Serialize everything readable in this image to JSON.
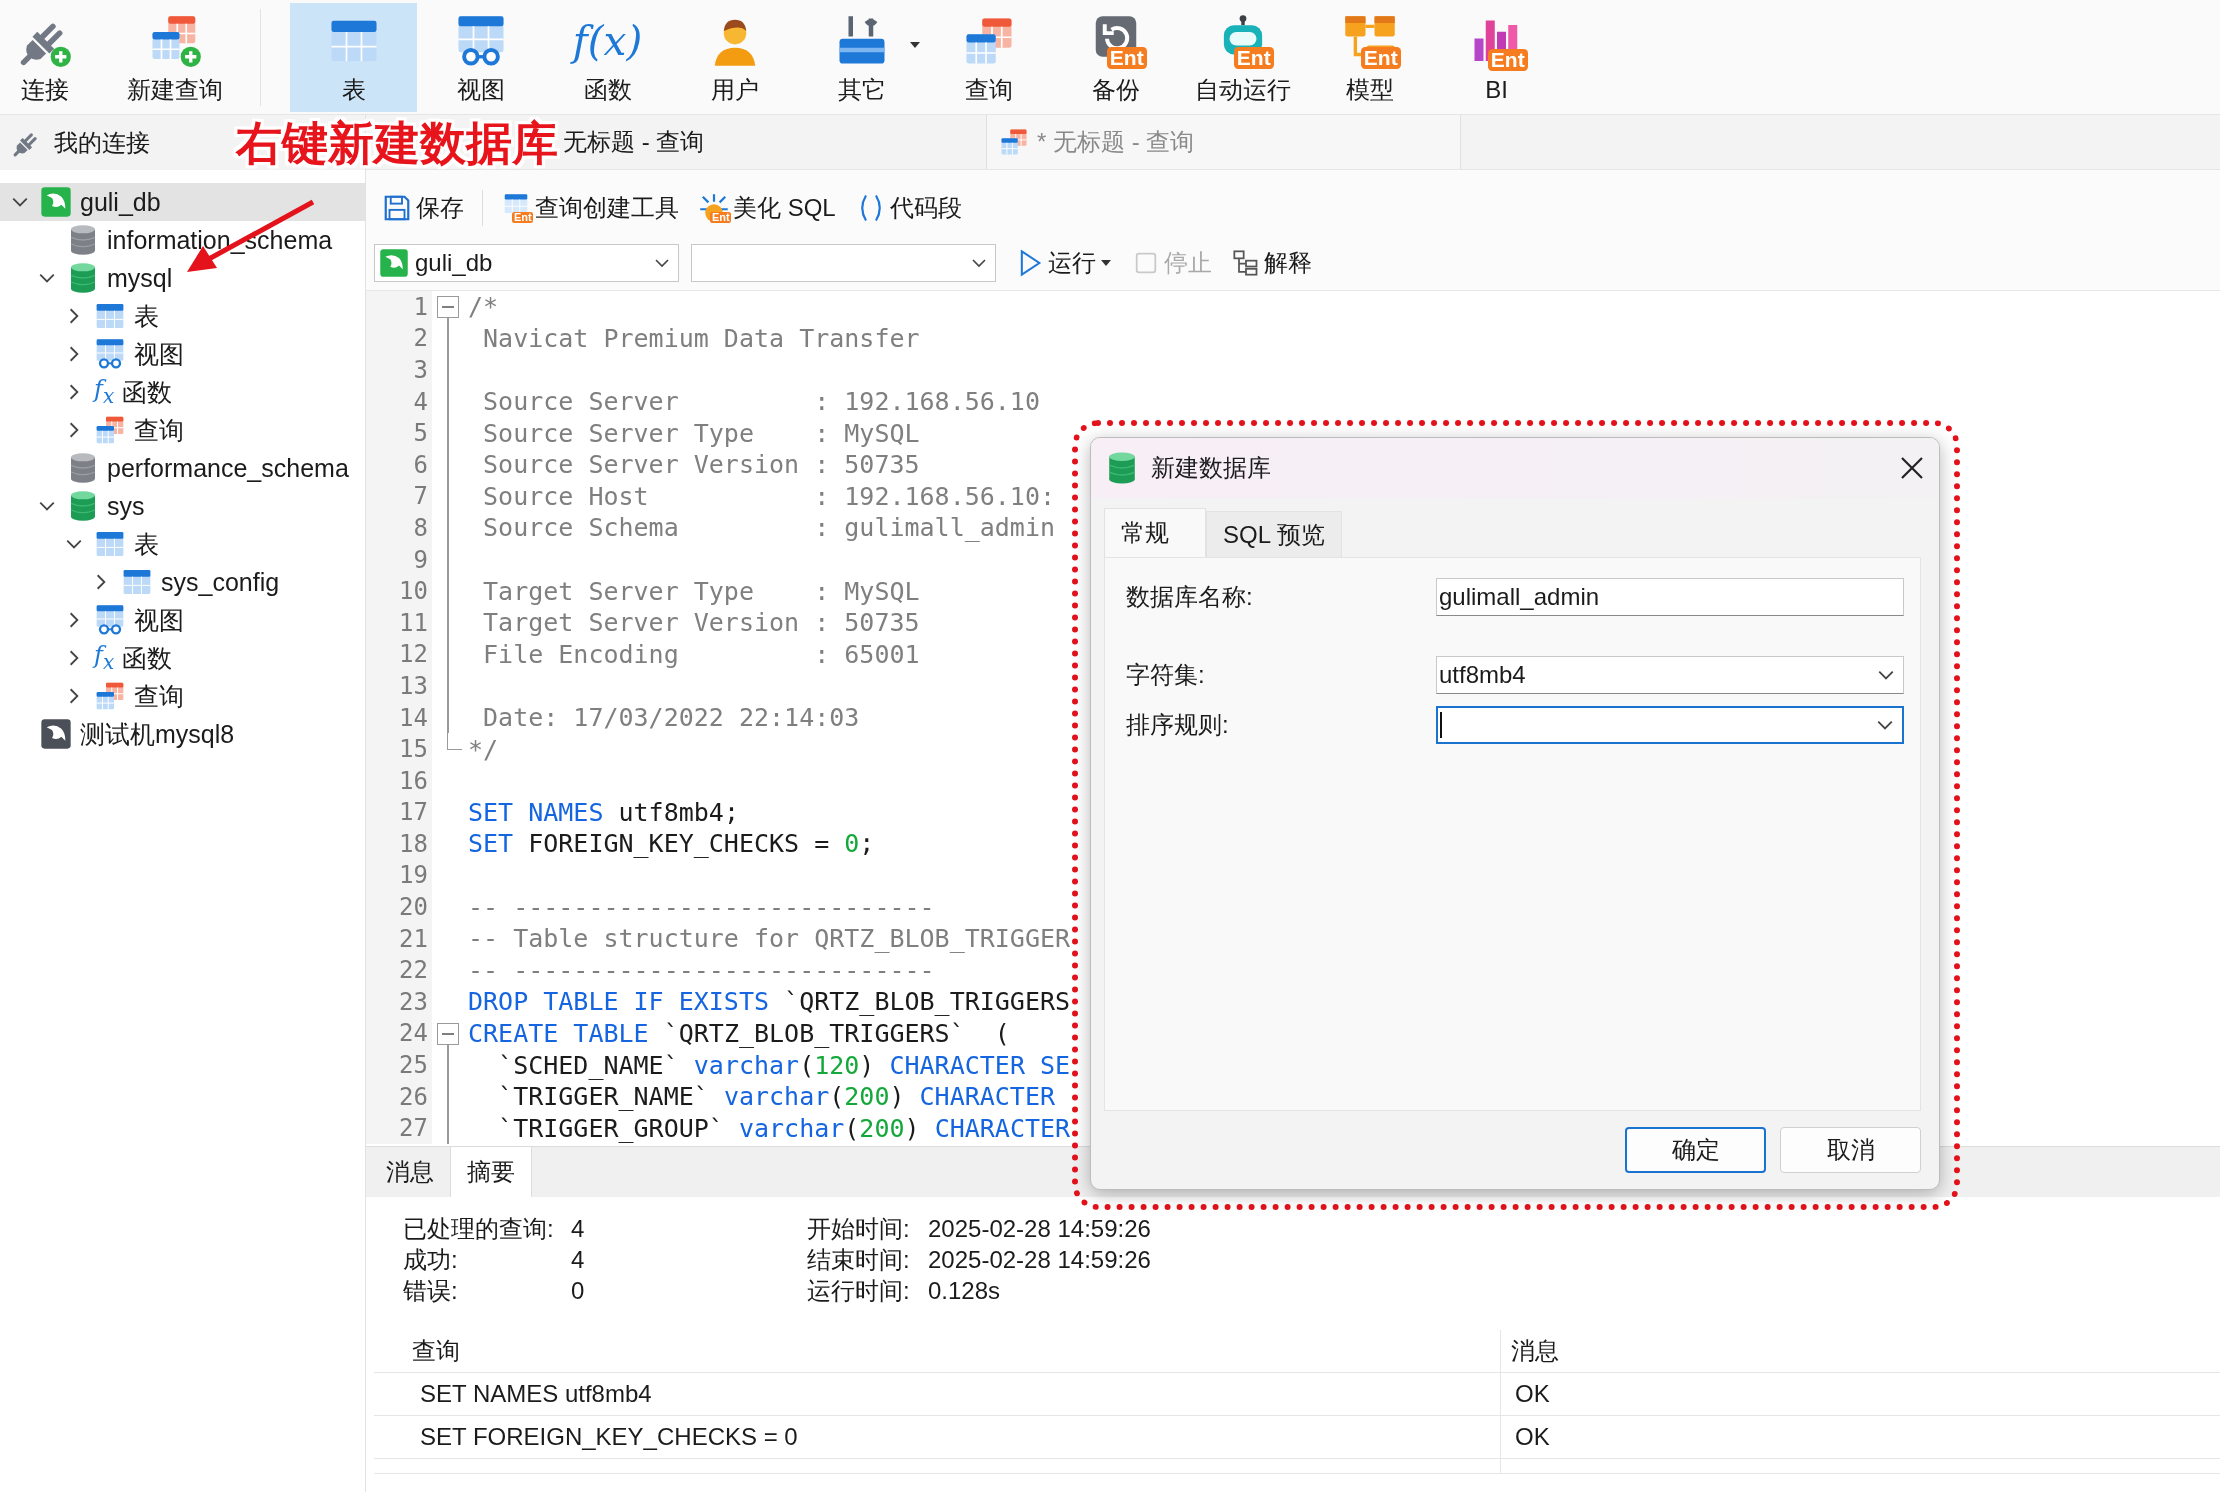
{
  "toolbar": {
    "items": [
      {
        "label": "连接",
        "kind": "connection",
        "selected": false,
        "dropdown": false
      },
      {
        "label": "新建查询",
        "kind": "new-query",
        "selected": false,
        "dropdown": false
      },
      {
        "label": "表",
        "kind": "table",
        "selected": true,
        "dropdown": false
      },
      {
        "label": "视图",
        "kind": "view",
        "selected": false,
        "dropdown": false
      },
      {
        "label": "函数",
        "kind": "function",
        "glyph": "f(x)",
        "selected": false,
        "dropdown": false
      },
      {
        "label": "用户",
        "kind": "user",
        "selected": false,
        "dropdown": false
      },
      {
        "label": "其它",
        "kind": "tools",
        "selected": false,
        "dropdown": true
      },
      {
        "label": "查询",
        "kind": "query",
        "selected": false,
        "dropdown": false
      },
      {
        "label": "备份",
        "kind": "backup",
        "badge": "Ent",
        "selected": false,
        "dropdown": false
      },
      {
        "label": "自动运行",
        "kind": "robot",
        "badge": "Ent",
        "selected": false,
        "dropdown": false
      },
      {
        "label": "模型",
        "kind": "model",
        "badge": "Ent",
        "selected": false,
        "dropdown": false
      },
      {
        "label": "BI",
        "kind": "bi",
        "badge": "Ent",
        "selected": false,
        "dropdown": false
      }
    ]
  },
  "annotation": {
    "text": "右键新建数据库"
  },
  "sidebar": {
    "title": "我的连接",
    "tree": [
      {
        "label": "guli_db",
        "kind": "connection",
        "opened": true,
        "expanded": true,
        "selected": true,
        "children": [
          {
            "label": "information_schema",
            "kind": "database",
            "opened": false,
            "selected": false
          },
          {
            "label": "mysql",
            "kind": "database",
            "opened": true,
            "expanded": true,
            "selected": false,
            "children": [
              {
                "label": "表",
                "kind": "table",
                "expanded": false,
                "selected": false
              },
              {
                "label": "视图",
                "kind": "view",
                "expanded": false,
                "selected": false
              },
              {
                "label": "函数",
                "kind": "function",
                "glyph": "f$_{x}$",
                "expanded": false,
                "selected": false
              },
              {
                "label": "查询",
                "kind": "query",
                "expanded": false,
                "selected": false
              }
            ]
          },
          {
            "label": "performance_schema",
            "kind": "database",
            "opened": false,
            "selected": false
          },
          {
            "label": "sys",
            "kind": "database",
            "opened": true,
            "expanded": true,
            "selected": false,
            "children": [
              {
                "label": "表",
                "kind": "table",
                "expanded": true,
                "selected": false,
                "children": [
                  {
                    "label": "sys_config",
                    "kind": "table",
                    "expanded": false,
                    "selected": false
                  }
                ]
              },
              {
                "label": "视图",
                "kind": "view",
                "expanded": false,
                "selected": false
              },
              {
                "label": "函数",
                "kind": "function",
                "glyph": "f$_{x}$",
                "expanded": false,
                "selected": false
              },
              {
                "label": "查询",
                "kind": "query",
                "expanded": false,
                "selected": false
              }
            ]
          }
        ]
      },
      {
        "label": "测试机mysql8",
        "kind": "connection",
        "opened": false,
        "selected": false
      }
    ]
  },
  "tabs": [
    {
      "label": "无标题 - 查询",
      "selected": true
    },
    {
      "label": "* 无标题 - 查询",
      "selected": false
    }
  ],
  "editor_toolbar": {
    "buttons": [
      {
        "label": "保存"
      },
      {
        "label": "查询创建工具",
        "badge": "Ent"
      },
      {
        "label": "美化 SQL",
        "badge": "Ent"
      },
      {
        "label": "代码段"
      }
    ],
    "database": "guli_db",
    "actions": [
      {
        "label": "运行",
        "disabled": false,
        "dropdown": true
      },
      {
        "label": "停止",
        "disabled": true,
        "dropdown": false
      },
      {
        "label": "解释",
        "disabled": false,
        "dropdown": false
      }
    ]
  },
  "editor": {
    "lines": [
      {
        "number": "1",
        "collapsible": true,
        "block_end": false,
        "tokens": [
          {
            "kind": "comment",
            "text": "/*"
          }
        ]
      },
      {
        "number": "2",
        "collapsible": false,
        "block_end": false,
        "tokens": [
          {
            "kind": "comment",
            "text": " Navicat Premium Data Transfer"
          }
        ]
      },
      {
        "number": "3",
        "collapsible": false,
        "block_end": false
      },
      {
        "number": "4",
        "collapsible": false,
        "block_end": false,
        "tokens": [
          {
            "kind": "comment",
            "text": " Source Server         : 192.168.56.10"
          }
        ]
      },
      {
        "number": "5",
        "collapsible": false,
        "block_end": false,
        "tokens": [
          {
            "kind": "comment",
            "text": " Source Server Type    : MySQL"
          }
        ]
      },
      {
        "number": "6",
        "collapsible": false,
        "block_end": false,
        "tokens": [
          {
            "kind": "comment",
            "text": " Source Server Version : 50735"
          }
        ]
      },
      {
        "number": "7",
        "collapsible": false,
        "block_end": false,
        "tokens": [
          {
            "kind": "comment",
            "text": " Source Host           : 192.168.56.10:"
          }
        ]
      },
      {
        "number": "8",
        "collapsible": false,
        "block_end": false,
        "tokens": [
          {
            "kind": "comment",
            "text": " Source Schema         : gulimall_admin"
          }
        ]
      },
      {
        "number": "9",
        "collapsible": false,
        "block_end": false
      },
      {
        "number": "10",
        "collapsible": false,
        "block_end": false,
        "tokens": [
          {
            "kind": "comment",
            "text": " Target Server Type    : MySQL"
          }
        ]
      },
      {
        "number": "11",
        "collapsible": false,
        "block_end": false,
        "tokens": [
          {
            "kind": "comment",
            "text": " Target Server Version : 50735"
          }
        ]
      },
      {
        "number": "12",
        "collapsible": false,
        "block_end": false,
        "tokens": [
          {
            "kind": "comment",
            "text": " File Encoding         : 65001"
          }
        ]
      },
      {
        "number": "13",
        "collapsible": false,
        "block_end": false
      },
      {
        "number": "14",
        "collapsible": false,
        "block_end": false,
        "tokens": [
          {
            "kind": "comment",
            "text": " Date: 17/03/2022 22:14:03"
          }
        ]
      },
      {
        "number": "15",
        "collapsible": false,
        "block_end": true,
        "tokens": [
          {
            "kind": "comment",
            "text": "*/"
          }
        ]
      },
      {
        "number": "16",
        "collapsible": false,
        "block_end": false
      },
      {
        "number": "17",
        "collapsible": false,
        "block_end": false,
        "tokens": [
          {
            "kind": "keyword",
            "text": "SET NAMES"
          },
          {
            "kind": "plain",
            "text": " utf8mb4;"
          }
        ]
      },
      {
        "number": "18",
        "collapsible": false,
        "block_end": false,
        "tokens": [
          {
            "kind": "keyword",
            "text": "SET"
          },
          {
            "kind": "plain",
            "text": " FOREIGN_KEY_CHECKS = "
          },
          {
            "kind": "number",
            "text": "0"
          },
          {
            "kind": "plain",
            "text": ";"
          }
        ]
      },
      {
        "number": "19",
        "collapsible": false,
        "block_end": false
      },
      {
        "number": "20",
        "collapsible": false,
        "block_end": false,
        "tokens": [
          {
            "kind": "comment",
            "text": "-- ----------------------------"
          }
        ]
      },
      {
        "number": "21",
        "collapsible": false,
        "block_end": false,
        "tokens": [
          {
            "kind": "comment",
            "text": "-- Table structure for QRTZ_BLOB_TRIGGER"
          }
        ]
      },
      {
        "number": "22",
        "collapsible": false,
        "block_end": false,
        "tokens": [
          {
            "kind": "comment",
            "text": "-- ----------------------------"
          }
        ]
      },
      {
        "number": "23",
        "collapsible": false,
        "block_end": false,
        "tokens": [
          {
            "kind": "keyword",
            "text": "DROP TABLE IF EXISTS"
          },
          {
            "kind": "plain",
            "text": " `QRTZ_BLOB_TRIGGERS"
          }
        ]
      },
      {
        "number": "24",
        "collapsible": true,
        "block_end": false,
        "tokens": [
          {
            "kind": "keyword",
            "text": "CREATE TABLE"
          },
          {
            "kind": "plain",
            "text": " `QRTZ_BLOB_TRIGGERS`  ("
          }
        ]
      },
      {
        "number": "25",
        "collapsible": false,
        "block_end": false,
        "tokens": [
          {
            "kind": "plain",
            "text": "  `SCHED_NAME` "
          },
          {
            "kind": "keyword",
            "text": "varchar"
          },
          {
            "kind": "plain",
            "text": "("
          },
          {
            "kind": "number",
            "text": "120"
          },
          {
            "kind": "plain",
            "text": ") "
          },
          {
            "kind": "keyword",
            "text": "CHARACTER SE"
          }
        ]
      },
      {
        "number": "26",
        "collapsible": false,
        "block_end": false,
        "tokens": [
          {
            "kind": "plain",
            "text": "  `TRIGGER_NAME` "
          },
          {
            "kind": "keyword",
            "text": "varchar"
          },
          {
            "kind": "plain",
            "text": "("
          },
          {
            "kind": "number",
            "text": "200"
          },
          {
            "kind": "plain",
            "text": ") "
          },
          {
            "kind": "keyword",
            "text": "CHARACTER"
          }
        ]
      },
      {
        "number": "27",
        "collapsible": false,
        "block_end": false,
        "tokens": [
          {
            "kind": "plain",
            "text": "  `TRIGGER_GROUP` "
          },
          {
            "kind": "keyword",
            "text": "varchar"
          },
          {
            "kind": "plain",
            "text": "("
          },
          {
            "kind": "number",
            "text": "200"
          },
          {
            "kind": "plain",
            "text": ") "
          },
          {
            "kind": "keyword",
            "text": "CHARACTER"
          }
        ]
      }
    ]
  },
  "output": {
    "tabs": [
      {
        "label": "消息",
        "selected": false
      },
      {
        "label": "摘要",
        "selected": true
      }
    ],
    "summary": [
      {
        "label": "已处理的查询:",
        "value": "4"
      },
      {
        "label": "成功:",
        "value": "4"
      },
      {
        "label": "错误:",
        "value": "0"
      }
    ],
    "timing": [
      {
        "label": "开始时间:",
        "value": "2025-02-28 14:59:26"
      },
      {
        "label": "结束时间:",
        "value": "2025-02-28 14:59:26"
      },
      {
        "label": "运行时间:",
        "value": "0.128s"
      }
    ],
    "columns": [
      "查询",
      "消息"
    ],
    "rows": [
      [
        "SET NAMES utf8mb4",
        "OK"
      ],
      [
        "SET FOREIGN_KEY_CHECKS = 0",
        "OK"
      ]
    ]
  },
  "dialog": {
    "title": "新建数据库",
    "tabs": [
      {
        "label": "常规",
        "selected": true
      },
      {
        "label": "SQL 预览",
        "selected": false
      }
    ],
    "fields": [
      {
        "label": "数据库名称:",
        "kind": "text",
        "value": "gulimall_admin",
        "focused": false
      },
      {
        "label": "字符集:",
        "kind": "select",
        "value": "utf8mb4",
        "focused": false
      },
      {
        "label": "排序规则:",
        "kind": "select",
        "focused": true
      }
    ],
    "buttons": [
      {
        "label": "确定",
        "default": true
      },
      {
        "label": "取消",
        "default": false
      }
    ]
  }
}
